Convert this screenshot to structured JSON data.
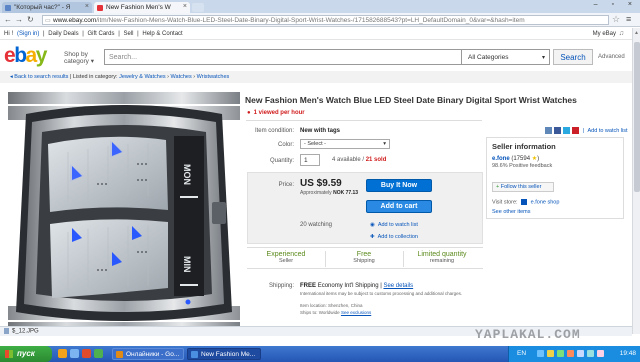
{
  "browser": {
    "tabs": [
      {
        "label": "\"Который час?\" - Я"
      },
      {
        "label": "New Fashion Men's W"
      }
    ],
    "url_domain": "www.ebay.com",
    "url_path": "/itm/New-Fashion-Mens-Watch-Blue-LED-Steel-Date-Binary-Digital-Sport-Wrist-Watches-/171582688543?pt=LH_DefaultDomain_0&var=&hash=item"
  },
  "ebay_topbar": {
    "greeting": "Hi",
    "user_suffix": "!",
    "signin": "(Sign in)",
    "links": [
      "Daily Deals",
      "Gift Cards",
      "Sell",
      "Help & Contact"
    ],
    "my_ebay": "My eBay"
  },
  "header": {
    "logo": [
      "e",
      "b",
      "a",
      "y"
    ],
    "shop_by_category": [
      "Shop by",
      "category"
    ],
    "search_placeholder": "Search...",
    "category_select": "All Categories",
    "search_button": "Search",
    "advanced": "Advanced"
  },
  "breadcrumb": {
    "back": "Back to search results",
    "listed_in": "Listed in category:",
    "path": [
      "Jewelry & Watches",
      "Watches",
      "Wristwatches"
    ]
  },
  "product": {
    "title": "New Fashion Men's Watch Blue LED Steel Date Binary Digital Sport Wrist Watches",
    "viewed": "1 viewed per hour",
    "condition_label": "Item condition:",
    "condition_value": "New with tags",
    "color_label": "Color:",
    "color_select": "- Select -",
    "quantity_label": "Quantity:",
    "quantity_value": "1",
    "available": "4 available",
    "sold": "21 sold",
    "price_label": "Price:",
    "price": "US $9.59",
    "approx_label": "Approximately",
    "approx_value": "NOK 77.13",
    "buy_it_now": "Buy It Now",
    "add_to_cart": "Add to cart",
    "watching": "20 watching",
    "add_watch": "Add to watch list",
    "add_collection": "Add to collection"
  },
  "badges": [
    {
      "big": "Experienced",
      "small": "Seller"
    },
    {
      "big": "Free",
      "small": "Shipping"
    },
    {
      "big": "Limited quantity",
      "small": "remaining"
    }
  ],
  "shipping": {
    "label": "Shipping:",
    "free": "FREE",
    "method": "Economy Int'l Shipping",
    "sep": "|",
    "details": "See details",
    "note": "International items may be subject to customs processing and additional charges.",
    "item_location": "Item location:  Shenzhen, China",
    "ships_to_label": "Ships to:  Worldwide",
    "exclusions": "See exclusions"
  },
  "share": {
    "add_watch": "Add to watch list",
    "icons": [
      {
        "name": "email-share-icon",
        "color": "#5f87b8"
      },
      {
        "name": "facebook-share-icon",
        "color": "#3b5998"
      },
      {
        "name": "twitter-share-icon",
        "color": "#2aa9e0"
      },
      {
        "name": "pinterest-share-icon",
        "color": "#cb2027"
      }
    ]
  },
  "seller": {
    "title": "Seller information",
    "name": "e.fone",
    "score": "(17594",
    "close": ")",
    "feedback": "98.6% Positive feedback",
    "follow": "Follow this seller",
    "visit_store": "Visit store:",
    "store_name": "e.fone shop",
    "other_items": "See other items"
  },
  "download": {
    "file": "$_12.JPG"
  },
  "watermark": "YAPLAKAL.COM",
  "taskbar": {
    "start": "пуск",
    "tasks": [
      "Онлайники - Go...",
      "New Fashion Me..."
    ],
    "lang": "EN",
    "clock": "19:48"
  },
  "colors": {
    "ebay_red": "#e53238",
    "ebay_blue": "#0064d2",
    "ebay_yellow": "#f5af02",
    "ebay_green": "#86b817",
    "button_blue": "#0070d4",
    "alert_red": "#d01b1b"
  }
}
